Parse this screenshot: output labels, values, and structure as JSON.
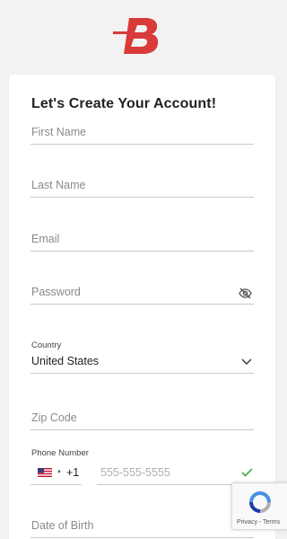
{
  "header": {
    "logo_name": "B"
  },
  "form": {
    "title": "Let's Create Your Account!",
    "first_name": {
      "placeholder": "First Name"
    },
    "last_name": {
      "placeholder": "Last Name"
    },
    "email": {
      "placeholder": "Email"
    },
    "password": {
      "placeholder": "Password"
    },
    "country": {
      "label": "Country",
      "value": "United States"
    },
    "zip": {
      "placeholder": "Zip Code"
    },
    "phone": {
      "label": "Phone Number",
      "country_code": "+1",
      "placeholder": "555-555-5555"
    },
    "dob": {
      "placeholder": "Date of Birth"
    }
  },
  "recaptcha": {
    "links": "Privacy - Terms"
  },
  "colors": {
    "brand_red": "#d93a3a",
    "valid_green": "#4caf50"
  }
}
